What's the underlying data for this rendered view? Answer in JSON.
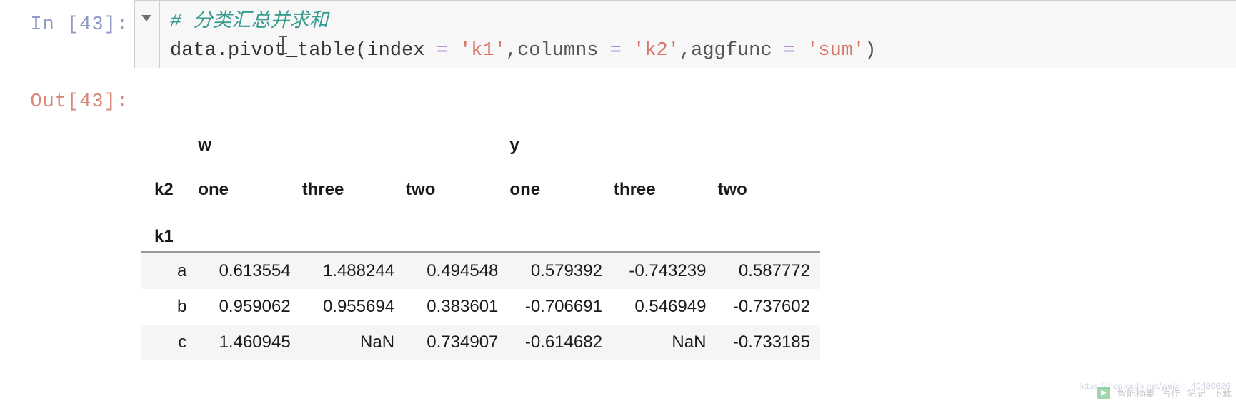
{
  "notebook": {
    "input_prompt": "In  [43]:",
    "output_prompt": "Out[43]:",
    "code": {
      "comment": "# 分类汇总并求和",
      "line2": {
        "name": "data.pivot_table(index",
        "op1": "=",
        "str1": "'k1'",
        "punct1": ",columns",
        "op2": "=",
        "str2": "'k2'",
        "punct2": ",aggfunc",
        "op3": "=",
        "str3": "'sum'",
        "punct3": ")"
      }
    }
  },
  "dataframe": {
    "index_name": "k1",
    "columns_name": "k2",
    "group_headers": [
      "w",
      "y"
    ],
    "sub_headers": [
      "one",
      "three",
      "two",
      "one",
      "three",
      "two"
    ],
    "rows": [
      {
        "label": "a",
        "values": [
          "0.613554",
          "1.488244",
          "0.494548",
          "0.579392",
          "-0.743239",
          "0.587772"
        ]
      },
      {
        "label": "b",
        "values": [
          "0.959062",
          "0.955694",
          "0.383601",
          "-0.706691",
          "0.546949",
          "-0.737602"
        ]
      },
      {
        "label": "c",
        "values": [
          "1.460945",
          "NaN",
          "0.734907",
          "-0.614682",
          "NaN",
          "-0.733185"
        ]
      }
    ]
  },
  "watermark": {
    "url": "https://blog.csdn.net/weixin_40480626",
    "play_label": "▶",
    "items": [
      "智能摘要",
      "写作",
      "笔记",
      "下载"
    ]
  }
}
